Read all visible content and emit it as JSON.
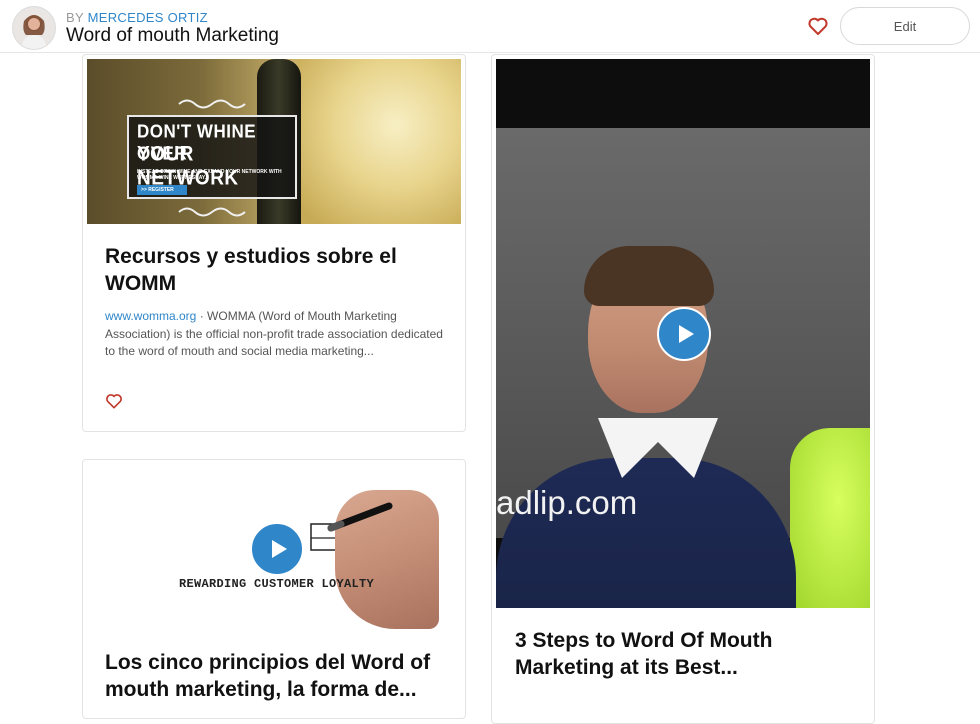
{
  "header": {
    "by_label": "BY",
    "author": "MERCEDES ORTIZ",
    "title": "Word of mouth Marketing",
    "edit_label": "Edit"
  },
  "cards": [
    {
      "type": "link",
      "image_text": {
        "line1": "DON'T WHINE OVER",
        "line2": "YOUR NETWORK",
        "line3": "INSTEAD DRINK WINE AND EXPAND YOUR NETWORK WITH WOMMA WINE WEDNESDAY.",
        "button": ">> REGISTER"
      },
      "title": "Recursos y estudios sobre el WOMM",
      "source": "www.womma.org",
      "separator": " · ",
      "description": "WOMMA (Word of Mouth Marketing Association) is the official non-profit trade association dedicated to the word of mouth and social media marketing..."
    },
    {
      "type": "video",
      "image_text": {
        "writing": "REWARDING CUSTOMER LOYALTY"
      },
      "title": "Los cinco principios del Word of mouth marketing, la forma de..."
    },
    {
      "type": "video",
      "image_text": {
        "watermark": "adlip.com"
      },
      "title": "3 Steps to Word Of Mouth Marketing at its Best..."
    }
  ],
  "icons": {
    "heart": "heart-icon",
    "play": "play-icon"
  },
  "colors": {
    "accent": "#2f86c9",
    "heart": "#c0392b"
  }
}
